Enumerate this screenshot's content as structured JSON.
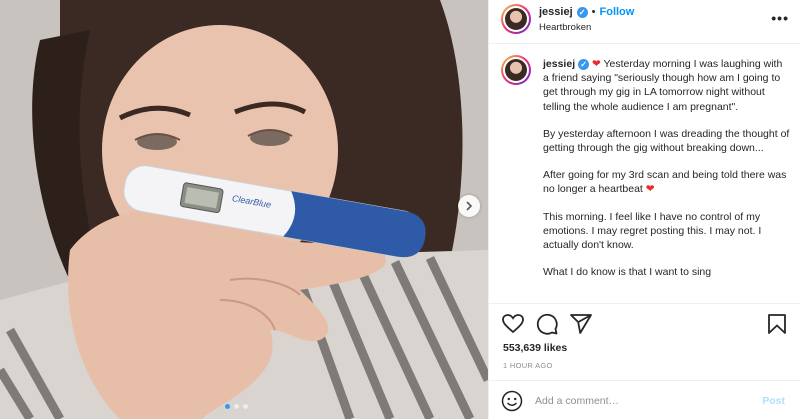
{
  "header": {
    "username": "jessiej",
    "verified_icon": "verified-badge-icon",
    "separator": "•",
    "follow_label": "Follow",
    "location": "Heartbroken",
    "more_icon": "more-options-icon"
  },
  "caption": {
    "username": "jessiej",
    "emoji": "❤",
    "paragraphs": [
      "Yesterday morning I was laughing with a friend saying \"seriously though how am I going to get through my gig in LA tomorrow night without telling the whole audience I am pregnant\".",
      "By yesterday afternoon I was dreading the thought of getting through the gig without breaking down...",
      "After going for my 3rd scan and being told there was no longer a heartbeat",
      "This morning. I feel like I have no control of my emotions. I may regret posting this. I may not. I actually don't know.",
      "What I do know is that I want to sing"
    ],
    "heart_after_para3": "❤"
  },
  "actions": {
    "like_icon": "heart-outline-icon",
    "comment_icon": "comment-icon",
    "share_icon": "share-icon",
    "save_icon": "bookmark-icon"
  },
  "likes": "553,639 likes",
  "time_ago": "1 HOUR AGO",
  "comment": {
    "emoji_icon": "emoji-icon",
    "placeholder": "Add a comment…",
    "post_label": "Post"
  },
  "photo": {
    "test_brand": "ClearBlue",
    "carousel_dots": 3,
    "active_dot": 1
  },
  "colors": {
    "accent": "#0095f6",
    "verified": "#3897f0",
    "heart": "#ed2a2a",
    "post_disabled": "#b2dffc"
  }
}
